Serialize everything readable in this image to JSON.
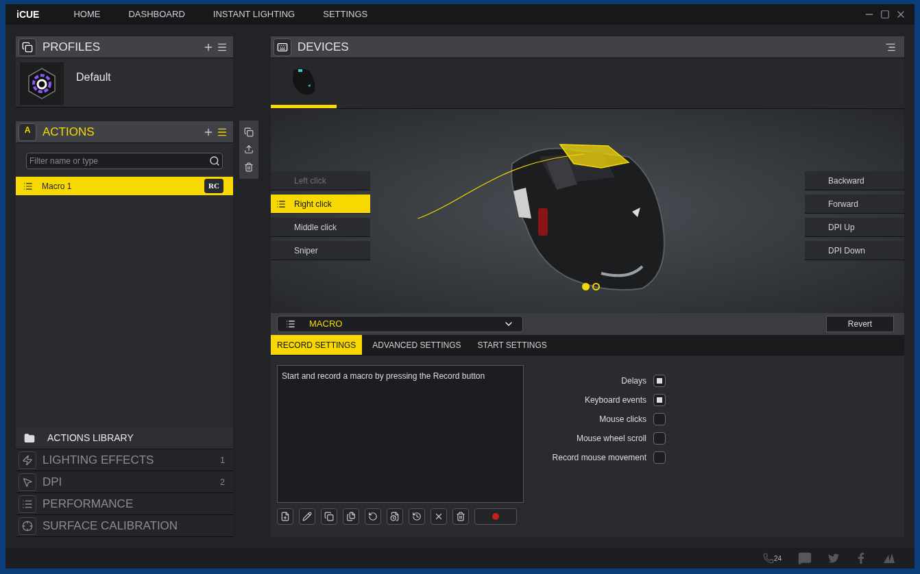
{
  "nav": {
    "brand": "iCUE",
    "items": [
      {
        "label": "HOME"
      },
      {
        "label": "DASHBOARD"
      },
      {
        "label": "INSTANT LIGHTING"
      },
      {
        "label": "SETTINGS"
      }
    ]
  },
  "profiles": {
    "title": "PROFILES",
    "items": [
      {
        "name": "Default"
      }
    ]
  },
  "actions": {
    "title": "ACTIONS",
    "icon_letter": "A",
    "filter": {
      "placeholder": "Filter name or type"
    },
    "items": [
      {
        "name": "Macro 1",
        "badge": "RC",
        "selected": true
      }
    ]
  },
  "library": {
    "title": "ACTIONS LIBRARY",
    "items": [
      {
        "kind": "lighting",
        "label": "LIGHTING EFFECTS",
        "count": "1"
      },
      {
        "kind": "dpi",
        "label": "DPI",
        "count": "2"
      },
      {
        "kind": "performance",
        "label": "PERFORMANCE"
      },
      {
        "kind": "surface",
        "label": "SURFACE CALIBRATION"
      }
    ]
  },
  "devices": {
    "title": "DEVICES",
    "tabs": [
      {
        "selected": true
      }
    ]
  },
  "left_buttons": [
    {
      "label": "Left click",
      "selected": false,
      "disabled": true
    },
    {
      "label": "Right click",
      "selected": true,
      "disabled": false
    },
    {
      "label": "Middle click",
      "selected": false,
      "disabled": false
    },
    {
      "label": "Sniper",
      "selected": false,
      "disabled": false
    }
  ],
  "right_buttons": [
    {
      "label": "Backward",
      "selected": false
    },
    {
      "label": "Forward",
      "selected": false
    },
    {
      "label": "DPI Up",
      "selected": false
    },
    {
      "label": "DPI Down",
      "selected": false
    }
  ],
  "page_dots": [
    {
      "selected": true
    },
    {
      "selected": false
    }
  ],
  "editor": {
    "type": "MACRO",
    "revert": "Revert",
    "tabs": [
      {
        "label": "RECORD SETTINGS",
        "selected": true
      },
      {
        "label": "ADVANCED SETTINGS",
        "selected": false
      },
      {
        "label": "START SETTINGS",
        "selected": false
      }
    ],
    "macro_text": "Start and record a macro by pressing the Record button",
    "options": [
      {
        "label": "Delays",
        "checked": true
      },
      {
        "label": "Keyboard events",
        "checked": true
      },
      {
        "label": "Mouse clicks",
        "checked": false
      },
      {
        "label": "Mouse wheel scroll",
        "checked": false
      },
      {
        "label": "Record mouse movement",
        "checked": false
      }
    ]
  },
  "footer": {
    "support_badge": "24"
  }
}
